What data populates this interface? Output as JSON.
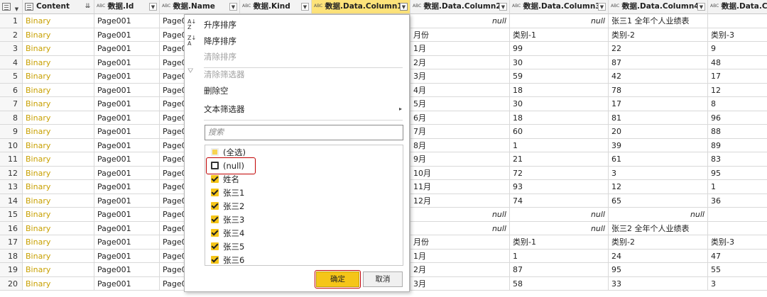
{
  "columns": [
    {
      "label": "",
      "type": "",
      "icon": "table-icon"
    },
    {
      "label": "Content",
      "type": "",
      "icon": "binary-type-icon"
    },
    {
      "label": "数据.Id",
      "type": "ABC 123"
    },
    {
      "label": "数据.Name",
      "type": "ABC 123"
    },
    {
      "label": "数据.Kind",
      "type": "ABC 123"
    },
    {
      "label": "数据.Data.Column1",
      "type": "ABC 123"
    },
    {
      "label": "数据.Data.Column2",
      "type": "ABC 123"
    },
    {
      "label": "数据.Data.Column3",
      "type": "ABC 123"
    },
    {
      "label": "数据.Data.Column4",
      "type": "ABC 123"
    },
    {
      "label": "数据.Data.Co",
      "type": "ABC 123"
    }
  ],
  "rows": [
    {
      "n": "1",
      "c": "Binary",
      "id": "Page001",
      "name": "Page0",
      "c2": "null",
      "c3": "null",
      "c4": "张三1 全年个人业绩表",
      "c5": ""
    },
    {
      "n": "2",
      "c": "Binary",
      "id": "Page001",
      "name": "Page0",
      "c2": "月份",
      "c3": "类别-1",
      "c4": "类别-2",
      "c5": "类别-3"
    },
    {
      "n": "3",
      "c": "Binary",
      "id": "Page001",
      "name": "Page0",
      "c2": "1月",
      "c3": "99",
      "c4": "22",
      "c5": "9"
    },
    {
      "n": "4",
      "c": "Binary",
      "id": "Page001",
      "name": "Page0",
      "c2": "2月",
      "c3": "30",
      "c4": "87",
      "c5": "48"
    },
    {
      "n": "5",
      "c": "Binary",
      "id": "Page001",
      "name": "Page0",
      "c2": "3月",
      "c3": "59",
      "c4": "42",
      "c5": "17"
    },
    {
      "n": "6",
      "c": "Binary",
      "id": "Page001",
      "name": "Page0",
      "c2": "4月",
      "c3": "18",
      "c4": "78",
      "c5": "12"
    },
    {
      "n": "7",
      "c": "Binary",
      "id": "Page001",
      "name": "Page0",
      "c2": "5月",
      "c3": "30",
      "c4": "17",
      "c5": "8"
    },
    {
      "n": "8",
      "c": "Binary",
      "id": "Page001",
      "name": "Page0",
      "c2": "6月",
      "c3": "18",
      "c4": "81",
      "c5": "96"
    },
    {
      "n": "9",
      "c": "Binary",
      "id": "Page001",
      "name": "Page0",
      "c2": "7月",
      "c3": "60",
      "c4": "20",
      "c5": "88"
    },
    {
      "n": "10",
      "c": "Binary",
      "id": "Page001",
      "name": "Page0",
      "c2": "8月",
      "c3": "1",
      "c4": "39",
      "c5": "89"
    },
    {
      "n": "11",
      "c": "Binary",
      "id": "Page001",
      "name": "Page0",
      "c2": "9月",
      "c3": "21",
      "c4": "61",
      "c5": "83"
    },
    {
      "n": "12",
      "c": "Binary",
      "id": "Page001",
      "name": "Page0",
      "c2": "10月",
      "c3": "72",
      "c4": "3",
      "c5": "95"
    },
    {
      "n": "13",
      "c": "Binary",
      "id": "Page001",
      "name": "Page0",
      "c2": "11月",
      "c3": "93",
      "c4": "12",
      "c5": "1"
    },
    {
      "n": "14",
      "c": "Binary",
      "id": "Page001",
      "name": "Page0",
      "c2": "12月",
      "c3": "74",
      "c4": "65",
      "c5": "36"
    },
    {
      "n": "15",
      "c": "Binary",
      "id": "Page001",
      "name": "Page0",
      "c2": "null",
      "c3": "null",
      "c4": "null",
      "c5": ""
    },
    {
      "n": "16",
      "c": "Binary",
      "id": "Page001",
      "name": "Page0",
      "c2": "null",
      "c3": "null",
      "c4": "张三2 全年个人业绩表",
      "c5": ""
    },
    {
      "n": "17",
      "c": "Binary",
      "id": "Page001",
      "name": "Page0",
      "c2": "月份",
      "c3": "类别-1",
      "c4": "类别-2",
      "c5": "类别-3"
    },
    {
      "n": "18",
      "c": "Binary",
      "id": "Page001",
      "name": "Page0",
      "c2": "1月",
      "c3": "1",
      "c4": "24",
      "c5": "47"
    },
    {
      "n": "19",
      "c": "Binary",
      "id": "Page001",
      "name": "Page0",
      "c2": "2月",
      "c3": "87",
      "c4": "95",
      "c5": "55"
    },
    {
      "n": "20",
      "c": "Binary",
      "id": "Page001",
      "name": "Page0",
      "c2": "3月",
      "c3": "58",
      "c4": "33",
      "c5": "3"
    }
  ],
  "menu": {
    "sort_asc": "升序排序",
    "sort_desc": "降序排序",
    "clear_sort": "清除排序",
    "clear_filter": "清除筛选器",
    "remove_empty": "删除空",
    "text_filter": "文本筛选器",
    "search_placeholder": "搜索",
    "items": [
      {
        "label": "(全选)",
        "state": "partial"
      },
      {
        "label": "(null)",
        "state": "off"
      },
      {
        "label": "姓名",
        "state": "on"
      },
      {
        "label": "张三1",
        "state": "on"
      },
      {
        "label": "张三2",
        "state": "on"
      },
      {
        "label": "张三3",
        "state": "on"
      },
      {
        "label": "张三4",
        "state": "on"
      },
      {
        "label": "张三5",
        "state": "on"
      },
      {
        "label": "张三6",
        "state": "on"
      }
    ],
    "ok": "确定",
    "cancel": "取消"
  },
  "colors": {
    "accent": "#f5c518",
    "binary_text": "#c8a000",
    "highlight_box": "#c00000"
  }
}
